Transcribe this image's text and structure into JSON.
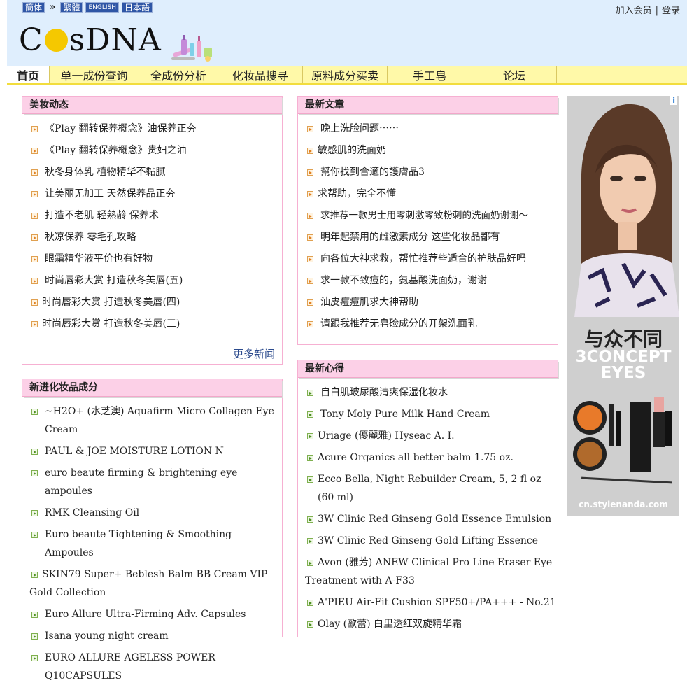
{
  "header": {
    "languages": [
      "簡体",
      "繁體",
      "ENGLISH",
      "日本語"
    ],
    "lang_separator": "»",
    "member_links": [
      "加入会员",
      "登录"
    ],
    "member_separator": "|",
    "logo_text": "CosDNA"
  },
  "nav": {
    "items": [
      "首页",
      "单一成份查询",
      "全成份分析",
      "化妆品搜寻",
      "原料成分买卖",
      "手工皂",
      "论坛"
    ],
    "active_index": 0
  },
  "beauty_news": {
    "title": "美妆动态",
    "items": [
      "《Play 翻转保养概念》油保养正夯",
      "《Play 翻转保养概念》贵妇之油",
      "秋冬身体乳  植物精华不黏腻",
      "让美丽无加工  天然保养品正夯",
      "打造不老肌  轻熟龄  保养术",
      "秋凉保养  零毛孔攻略",
      "眼霜精华液平价也有好物",
      "时尚唇彩大赏  打造秋冬美唇(五)",
      "时尚唇彩大赏  打造秋冬美唇(四)",
      "时尚唇彩大赏  打造秋冬美唇(三)"
    ],
    "more_label": "更多新闻"
  },
  "latest_articles": {
    "title": "最新文章",
    "items": [
      "晚上洗脸问题⋯⋯",
      "敏感肌的洗面奶",
      "幫你找到合適的護膚品3",
      "求帮助，完全不懂",
      "求推荐一款男士用零刺激零致粉刺的洗面奶谢谢～",
      "明年起禁用的雌激素成分    这些化妆品都有",
      "向各位大神求救，帮忙推荐些适合的护肤品好吗",
      "求一款不致痘的，氨基酸洗面奶，谢谢",
      "油皮痘痘肌求大神帮助",
      "请跟我推荐无皂硷成分的开架洗面乳"
    ]
  },
  "new_products": {
    "title": "新进化妆品成分",
    "items": [
      " ~H2O+ (水芝澳) Aquafirm Micro Collagen Eye Cream",
      "PAUL & JOE MOISTURE LOTION N",
      "euro beaute firming & brightening eye ampoules",
      "RMK Cleansing Oil",
      "Euro beaute Tightening & Smoothing Ampoules",
      "SKIN79 Super+ Beblesh Balm BB Cream VIP Gold Collection",
      "Euro Allure Ultra-Firming Adv. Capsules",
      "Isana young night cream",
      "EURO ALLURE AGELESS POWER Q10CAPSULES"
    ]
  },
  "latest_reviews": {
    "title": "最新心得",
    "items": [
      "自白肌玻尿酸清爽保湿化妆水",
      "Tony Moly Pure Milk Hand Cream",
      "Uriage (優麗雅) Hyseac A. I.",
      "Acure Organics all better balm 1.75 oz.",
      "Ecco Bella, Night Rebuilder Cream, 5, 2 fl oz (60 ml)",
      "3W Clinic Red Ginseng Gold Essence Emulsion",
      "3W Clinic Red Ginseng Gold Lifting Essence",
      "Avon (雅芳) ANEW Clinical Pro Line Eraser Eye Treatment with A-F33",
      "A'PIEU Air-Fit Cushion SPF50+/PA+++ - No.21",
      "Olay (歐蕾) 白里透红双旋精华霜"
    ]
  },
  "ad": {
    "info_badge": "i",
    "headline": "与众不同",
    "brand": "3CONCEPT EYES",
    "url": "cn.stylenanda.com"
  }
}
